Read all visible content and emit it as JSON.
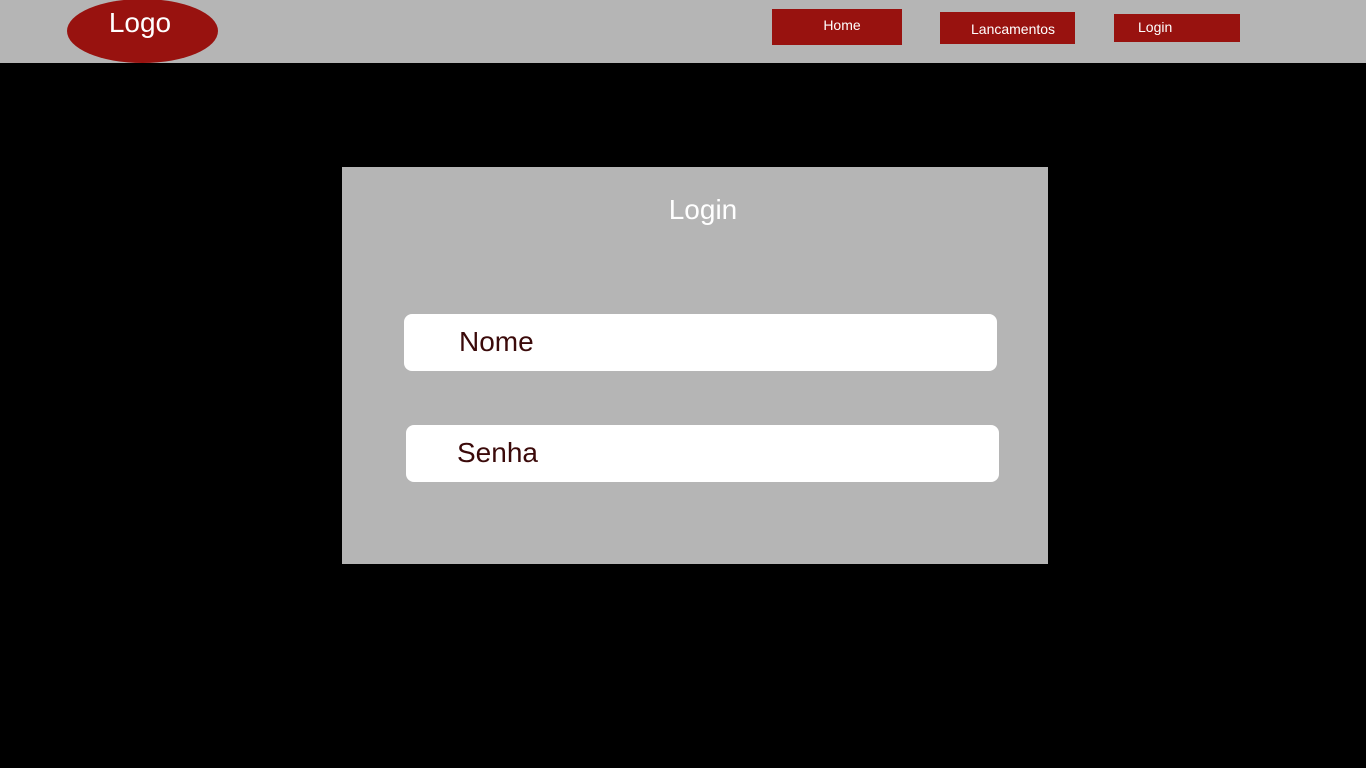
{
  "header": {
    "logo_label": "Logo",
    "nav": {
      "home": "Home",
      "lancamentos": "Lancamentos",
      "login": "Login"
    }
  },
  "login_form": {
    "title": "Login",
    "nome_field": "Nome",
    "senha_field": "Senha"
  },
  "colors": {
    "header_bg": "#b5b5b5",
    "accent": "#98120f",
    "page_bg": "#000000",
    "card_bg": "#b5b5b5",
    "field_text": "#3b0a0a"
  }
}
